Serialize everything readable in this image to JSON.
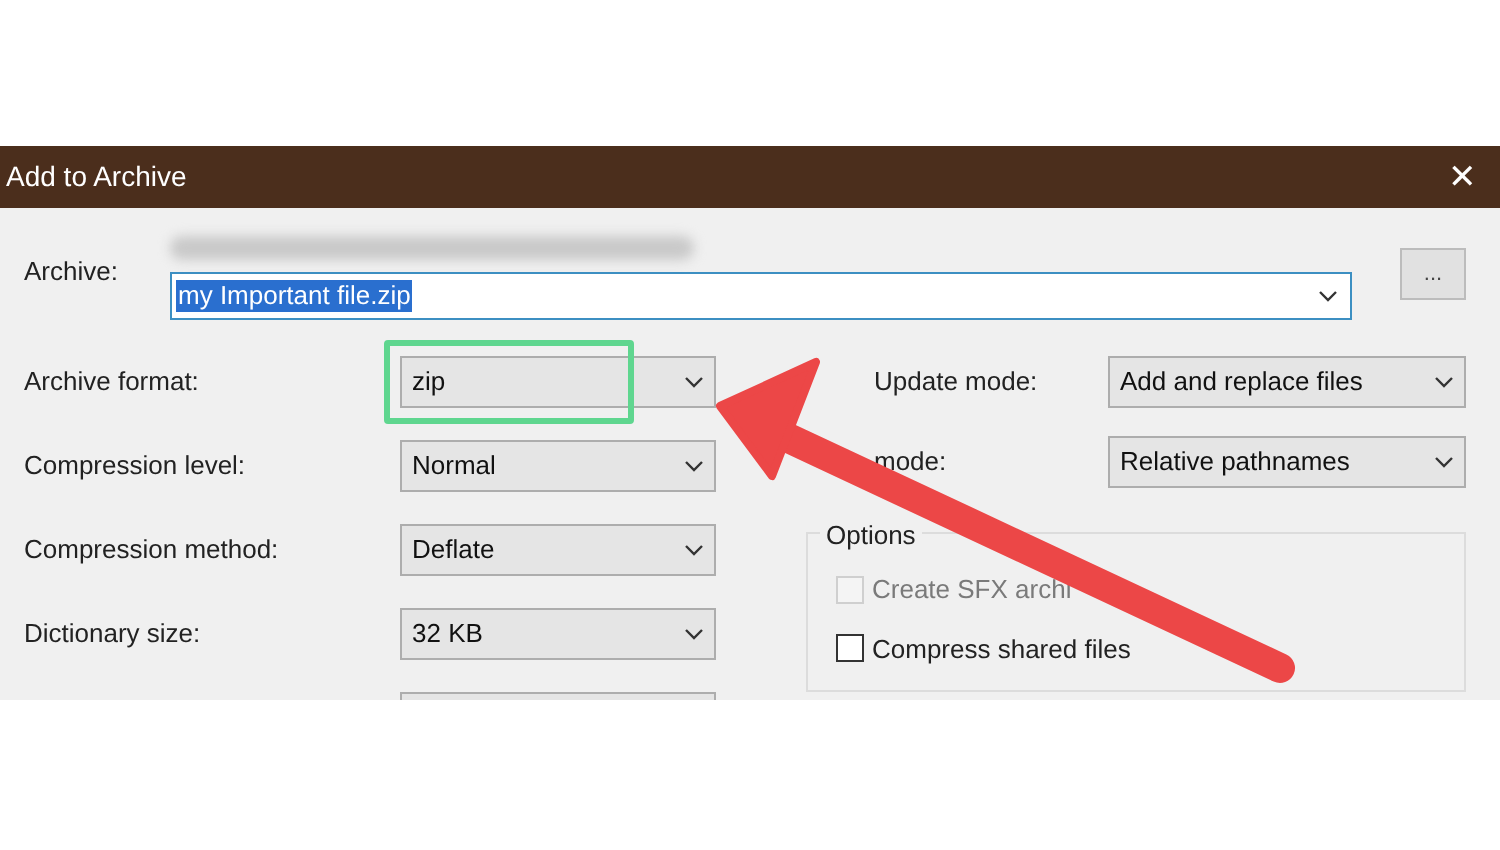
{
  "window": {
    "title": "Add to Archive",
    "close": "✕"
  },
  "archive": {
    "label": "Archive:",
    "value": "my Important file.zip",
    "browse": "..."
  },
  "left_fields": [
    {
      "label": "Archive format:",
      "value": "zip",
      "highlighted": true
    },
    {
      "label": "Compression level:",
      "value": "Normal",
      "highlighted": false
    },
    {
      "label": "Compression method:",
      "value": "Deflate",
      "highlighted": false
    },
    {
      "label": "Dictionary size:",
      "value": "32 KB",
      "highlighted": false
    }
  ],
  "right_fields": [
    {
      "label": "Update mode:",
      "value": "Add and replace files"
    },
    {
      "label": "mode:",
      "value": "Relative pathnames"
    }
  ],
  "options": {
    "title": "Options",
    "items": [
      {
        "label": "Create SFX archi",
        "checked": false,
        "disabled": true
      },
      {
        "label": "Compress shared files",
        "checked": false,
        "disabled": false
      }
    ]
  }
}
